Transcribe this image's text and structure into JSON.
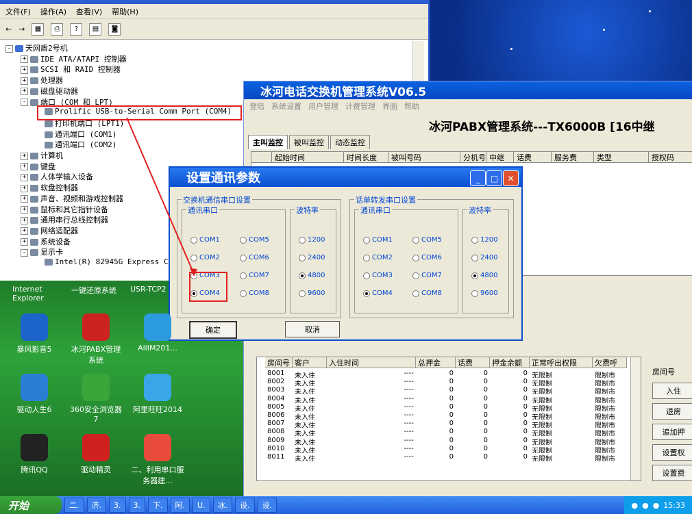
{
  "devmgr": {
    "menu": [
      "文件(F)",
      "操作(A)",
      "查看(V)",
      "帮助(H)"
    ],
    "tree": [
      {
        "label": "天网盾2号机",
        "indent": 0,
        "expand": "-"
      },
      {
        "label": "IDE ATA/ATAPI 控制器",
        "indent": 1,
        "expand": "+"
      },
      {
        "label": "SCSI 和 RAID 控制器",
        "indent": 1,
        "expand": "+"
      },
      {
        "label": "处理器",
        "indent": 1,
        "expand": "+"
      },
      {
        "label": "磁盘驱动器",
        "indent": 1,
        "expand": "+"
      },
      {
        "label": "端口 (COM 和 LPT)",
        "indent": 1,
        "expand": "-"
      },
      {
        "label": "Prolific USB-to-Serial Comm Port (COM4)",
        "indent": 2,
        "expand": ""
      },
      {
        "label": "打印机端口 (LPT1)",
        "indent": 2,
        "expand": ""
      },
      {
        "label": "通讯端口 (COM1)",
        "indent": 2,
        "expand": ""
      },
      {
        "label": "通讯端口 (COM2)",
        "indent": 2,
        "expand": ""
      },
      {
        "label": "计算机",
        "indent": 1,
        "expand": "+"
      },
      {
        "label": "键盘",
        "indent": 1,
        "expand": "+"
      },
      {
        "label": "人体学输入设备",
        "indent": 1,
        "expand": "+"
      },
      {
        "label": "软盘控制器",
        "indent": 1,
        "expand": "+"
      },
      {
        "label": "声音、视频和游戏控制器",
        "indent": 1,
        "expand": "+"
      },
      {
        "label": "鼠标和其它指针设备",
        "indent": 1,
        "expand": "+"
      },
      {
        "label": "通用串行总线控制器",
        "indent": 1,
        "expand": "+"
      },
      {
        "label": "网络适配器",
        "indent": 1,
        "expand": "+"
      },
      {
        "label": "系统设备",
        "indent": 1,
        "expand": "+"
      },
      {
        "label": "显示卡",
        "indent": 1,
        "expand": "-"
      },
      {
        "label": "Intel(R) 82945G Express C",
        "indent": 2,
        "expand": ""
      }
    ]
  },
  "app": {
    "title": "冰河电话交换机管理系统V06.5",
    "menu": [
      "登陆",
      "系统设置",
      "用户管理",
      "计费管理",
      "界面",
      "帮助"
    ],
    "banner": "冰河PABX管理系统---TX6000B [16中继",
    "tabs": [
      "主叫监控",
      "被叫监控",
      "动态监控"
    ],
    "top_headers": [
      "起始时间",
      "时间长度",
      "被叫号码",
      "分机号",
      "中继",
      "话费",
      "服务费",
      "类型",
      "授权码"
    ],
    "bottom_headers": [
      "房间号",
      "客户",
      "入住时间",
      "总押金",
      "话费",
      "押金余额",
      "正常呼出权限",
      "欠费呼"
    ],
    "rows": [
      {
        "room": "8001",
        "status": "未入住",
        "time": "----",
        "deposit": "0",
        "fee": "0",
        "balance": "0",
        "perm": "无限制",
        "owe": "限制市"
      },
      {
        "room": "8002",
        "status": "未入住",
        "time": "----",
        "deposit": "0",
        "fee": "0",
        "balance": "0",
        "perm": "无限制",
        "owe": "限制市"
      },
      {
        "room": "8003",
        "status": "未入住",
        "time": "----",
        "deposit": "0",
        "fee": "0",
        "balance": "0",
        "perm": "无限制",
        "owe": "限制市"
      },
      {
        "room": "8004",
        "status": "未入住",
        "time": "----",
        "deposit": "0",
        "fee": "0",
        "balance": "0",
        "perm": "无限制",
        "owe": "限制市"
      },
      {
        "room": "8005",
        "status": "未入住",
        "time": "----",
        "deposit": "0",
        "fee": "0",
        "balance": "0",
        "perm": "无限制",
        "owe": "限制市"
      },
      {
        "room": "8006",
        "status": "未入住",
        "time": "----",
        "deposit": "0",
        "fee": "0",
        "balance": "0",
        "perm": "无限制",
        "owe": "限制市"
      },
      {
        "room": "8007",
        "status": "未入住",
        "time": "----",
        "deposit": "0",
        "fee": "0",
        "balance": "0",
        "perm": "无限制",
        "owe": "限制市"
      },
      {
        "room": "8008",
        "status": "未入住",
        "time": "----",
        "deposit": "0",
        "fee": "0",
        "balance": "0",
        "perm": "无限制",
        "owe": "限制市"
      },
      {
        "room": "8009",
        "status": "未入住",
        "time": "----",
        "deposit": "0",
        "fee": "0",
        "balance": "0",
        "perm": "无限制",
        "owe": "限制市"
      },
      {
        "room": "8010",
        "status": "未入住",
        "time": "----",
        "deposit": "0",
        "fee": "0",
        "balance": "0",
        "perm": "无限制",
        "owe": "限制市"
      },
      {
        "room": "8011",
        "status": "未入住",
        "time": "----",
        "deposit": "0",
        "fee": "0",
        "balance": "0",
        "perm": "无限制",
        "owe": "限制市"
      }
    ],
    "side": {
      "room_label": "房间号",
      "buttons": [
        "入住",
        "退房",
        "追加押",
        "设置权",
        "设置费"
      ]
    }
  },
  "dialog": {
    "title": "设置通讯参数",
    "left_group": "交换机通信串口设置",
    "right_group": "话单转发串口设置",
    "port_label": "通讯串口",
    "baud_label": "波特率",
    "ports": [
      "COM1",
      "COM2",
      "COM3",
      "COM4",
      "COM5",
      "COM6",
      "COM7",
      "COM8"
    ],
    "bauds": [
      "1200",
      "2400",
      "4800",
      "9600"
    ],
    "left_port_selected": "COM4",
    "left_baud_selected": "4800",
    "right_port_selected": "COM4",
    "right_baud_selected": "4800",
    "ok": "确定",
    "cancel": "取消"
  },
  "desktop": {
    "top_labels": [
      "Internet Explorer",
      "一键还原系统",
      "USR-TCP2"
    ],
    "icons": [
      {
        "label": "暴风影音5"
      },
      {
        "label": "冰河PABX管理系统"
      },
      {
        "label": "AliIM201..."
      },
      {
        "label": "驱动人生6"
      },
      {
        "label": "360安全浏览器7"
      },
      {
        "label": "阿里旺旺2014"
      },
      {
        "label": "腾讯QQ"
      },
      {
        "label": "驱动精灵"
      },
      {
        "label": "二、利用串口服务器建..."
      }
    ]
  },
  "taskbar": {
    "start": "开始",
    "tasks": [
      "二.",
      "济.",
      "3.",
      "3.",
      "下.",
      "阿.",
      "U.",
      "冰.",
      "设.",
      "设."
    ],
    "clock": "15:33"
  }
}
